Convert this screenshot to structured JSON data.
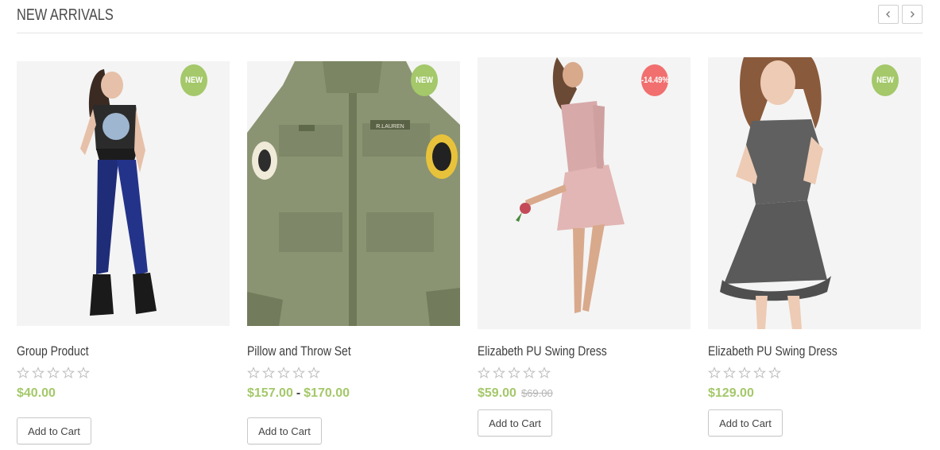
{
  "section": {
    "title": "NEW ARRIVALS",
    "prev_icon": "chevron-left-icon",
    "next_icon": "chevron-right-icon"
  },
  "products": [
    {
      "name": "Group Product",
      "badge": "NEW",
      "badge_type": "new",
      "rating": 0,
      "price": "$40.00",
      "price_to": "",
      "old_price": "",
      "cart_label": "Add to Cart"
    },
    {
      "name": "Pillow and Throw Set",
      "badge": "NEW",
      "badge_type": "new",
      "rating": 0,
      "price": "$157.00",
      "price_sep": "-",
      "price_to": "$170.00",
      "old_price": "",
      "cart_label": "Add to Cart"
    },
    {
      "name": "Elizabeth PU Swing Dress",
      "badge": "-14.49%",
      "badge_type": "sale",
      "rating": 0,
      "price": "$59.00",
      "price_to": "",
      "old_price": "$69.00",
      "cart_label": "Add to Cart"
    },
    {
      "name": "Elizabeth PU Swing Dress",
      "badge": "NEW",
      "badge_type": "new",
      "rating": 0,
      "price": "$129.00",
      "price_to": "",
      "old_price": "",
      "cart_label": "Add to Cart"
    }
  ],
  "colors": {
    "accent_green": "#a4c86a",
    "sale_red": "#f16f6f",
    "star_empty": "#bdbdbd"
  }
}
